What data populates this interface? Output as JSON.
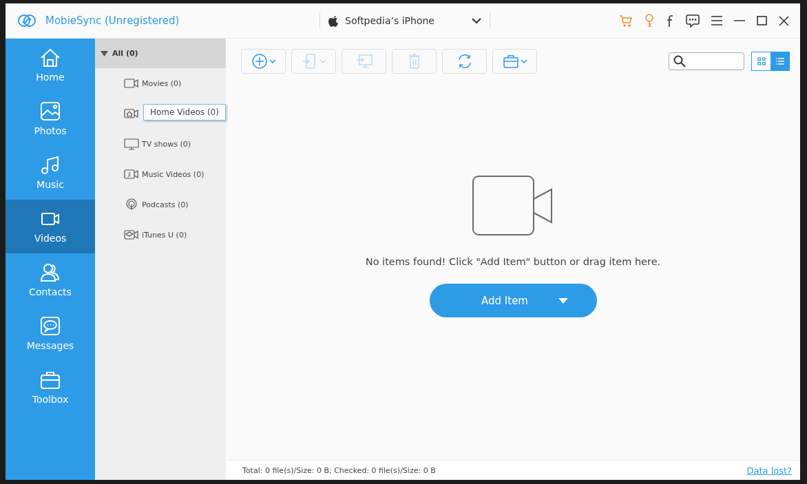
{
  "window": {
    "title": "MobieSync (Unregistered)"
  },
  "device": {
    "name": "Softpedia’s iPhone"
  },
  "header_icons": [
    {
      "kind": "cart"
    },
    {
      "kind": "key"
    },
    {
      "kind": "facebook"
    },
    {
      "kind": "feedback"
    },
    {
      "kind": "menu"
    },
    {
      "kind": "minimize"
    },
    {
      "kind": "maximize"
    },
    {
      "kind": "close"
    }
  ],
  "sidebar": {
    "items": [
      {
        "kind": "home",
        "label": "Home",
        "selected": false
      },
      {
        "kind": "photos",
        "label": "Photos",
        "selected": false
      },
      {
        "kind": "music",
        "label": "Music",
        "selected": false
      },
      {
        "kind": "videos",
        "label": "Videos",
        "selected": true
      },
      {
        "kind": "contacts",
        "label": "Contacts",
        "selected": false
      },
      {
        "kind": "messages",
        "label": "Messages",
        "selected": false
      },
      {
        "kind": "toolbox",
        "label": "Toolbox",
        "selected": false
      }
    ]
  },
  "categories": {
    "header": {
      "label": "All (0)",
      "expanded": true
    },
    "items": [
      {
        "kind": "movie",
        "label": "Movies (0)"
      },
      {
        "kind": "home-video"
      },
      {
        "kind": "tv",
        "label": "TV shows (0)"
      },
      {
        "kind": "music-video",
        "label": "Music Videos (0)"
      },
      {
        "kind": "podcast",
        "label": "Podcasts (0)"
      },
      {
        "kind": "itunes-u",
        "label": "iTunes U (0)"
      }
    ]
  },
  "tooltip": {
    "text": "Home Videos (0)"
  },
  "toolbar": [
    {
      "kind": "add",
      "disabled": false,
      "dropdown": true
    },
    {
      "kind": "to-device",
      "disabled": true,
      "dropdown": true
    },
    {
      "kind": "to-pc",
      "disabled": true,
      "dropdown": false
    },
    {
      "kind": "delete",
      "disabled": true,
      "dropdown": false
    },
    {
      "kind": "sync",
      "disabled": false,
      "dropdown": false
    },
    {
      "kind": "toolbox",
      "disabled": false,
      "dropdown": true
    }
  ],
  "view_toggle": [
    {
      "kind": "grid",
      "selected": false
    },
    {
      "kind": "list",
      "selected": true
    }
  ],
  "empty_state": {
    "message": "No items found! Click \"Add Item\" button or drag item here.",
    "button": "Add Item"
  },
  "status_bar": {
    "summary": "Total: 0 file(s)/Size: 0 B; Checked: 0 file(s)/Size: 0 B",
    "link": "Data lost?"
  }
}
